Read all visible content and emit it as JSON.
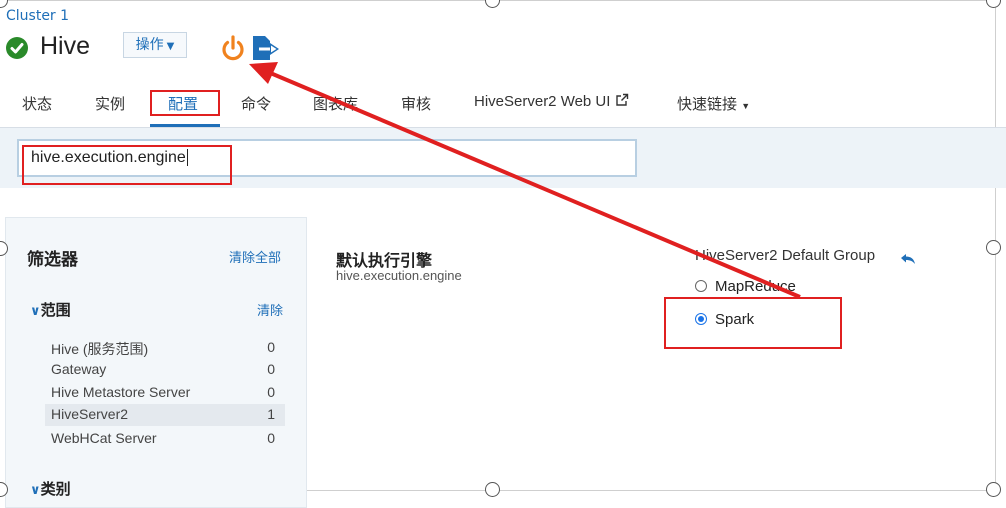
{
  "header": {
    "cluster": "Cluster 1",
    "service": "Hive",
    "actions_label": "操作",
    "power_icon": "power-icon",
    "export_icon": "export-icon"
  },
  "tabs": [
    {
      "label": "状态"
    },
    {
      "label": "实例"
    },
    {
      "label": "配置",
      "active": true
    },
    {
      "label": "命令"
    },
    {
      "label": "图表库"
    },
    {
      "label": "审核"
    },
    {
      "label": "HiveServer2 Web UI"
    },
    {
      "label": "快速链接"
    }
  ],
  "search": {
    "value": "hive.execution.engine"
  },
  "filters": {
    "title": "筛选器",
    "clear_all": "清除全部",
    "scope": {
      "title": "范围",
      "clear": "清除",
      "items": [
        {
          "label": "Hive (服务范围)",
          "count": "0"
        },
        {
          "label": "Gateway",
          "count": "0"
        },
        {
          "label": "Hive Metastore Server",
          "count": "0"
        },
        {
          "label": "HiveServer2",
          "count": "1",
          "selected": true
        },
        {
          "label": "WebHCat Server",
          "count": "0"
        }
      ]
    },
    "category_title": "类别"
  },
  "config": {
    "name": "默认执行引擎",
    "key": "hive.execution.engine",
    "group": "HiveServer2 Default Group",
    "options": [
      {
        "label": "MapReduce",
        "checked": false
      },
      {
        "label": "Spark",
        "checked": true
      }
    ]
  },
  "colors": {
    "accent": "#1f6fb8",
    "annotation": "#e02020",
    "power": "#f0821e",
    "ok": "#2a8a2a"
  }
}
